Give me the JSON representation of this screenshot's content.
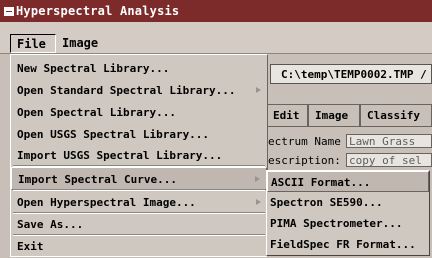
{
  "window": {
    "title": "Hyperspectral Analysis"
  },
  "menubar": {
    "file_label": "File",
    "image_label": "Image"
  },
  "background": {
    "path_value": "C:\\temp\\TEMP0002.TMP /",
    "tabs": [
      {
        "label": "Edit"
      },
      {
        "label": "Image"
      },
      {
        "label": "Classify"
      }
    ],
    "spectrum_name_label": "ectrum Name",
    "spectrum_name_value": "Lawn_Grass",
    "description_label": "escription:",
    "description_value": "copy of sel"
  },
  "file_menu": {
    "items": [
      {
        "label": "New Spectral Library...",
        "submenu": false
      },
      {
        "label": "Open Standard Spectral Library...",
        "submenu": true
      },
      {
        "label": "Open Spectral Library...",
        "submenu": false
      },
      {
        "label": "Open USGS Spectral Library...",
        "submenu": false
      },
      {
        "label": "Import USGS Spectral Library...",
        "submenu": false
      },
      {
        "label": "Import Spectral Curve...",
        "submenu": true,
        "active": true
      },
      {
        "label": "Open Hyperspectral Image...",
        "submenu": true
      },
      {
        "label": "Save As...",
        "submenu": false
      },
      {
        "label": "Exit",
        "submenu": false
      }
    ]
  },
  "import_submenu": {
    "items": [
      {
        "label": "ASCII Format...",
        "active": true
      },
      {
        "label": "Spectron SE590..."
      },
      {
        "label": "PIMA Spectrometer..."
      },
      {
        "label": "FieldSpec FR Format..."
      }
    ]
  },
  "colors": {
    "titlebar": "#7c2a2a",
    "menu_bg": "#cfc8c1",
    "highlight": "#c0b8b0"
  }
}
